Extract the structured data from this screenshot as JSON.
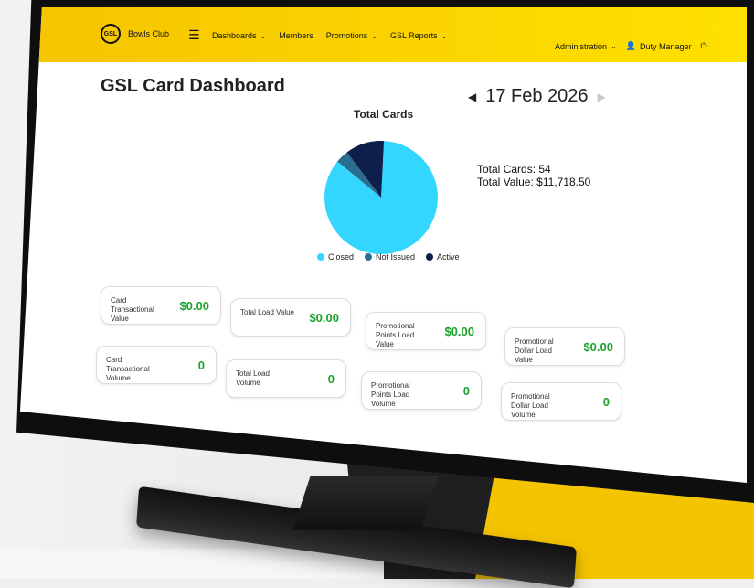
{
  "brand": {
    "name": "Bowls Club",
    "logo_text": "GSL"
  },
  "nav": {
    "items": [
      {
        "label": "Dashboards",
        "dropdown": true
      },
      {
        "label": "Members",
        "dropdown": false
      },
      {
        "label": "Promotions",
        "dropdown": true
      },
      {
        "label": "GSL Reports",
        "dropdown": true
      }
    ],
    "right": {
      "admin": "Administration",
      "user": "Duty Manager"
    }
  },
  "page": {
    "title": "GSL Card Dashboard",
    "date": "17 Feb 2026"
  },
  "chart": {
    "title": "Total Cards",
    "legend": [
      {
        "label": "Closed",
        "color": "#33d6ff"
      },
      {
        "label": "Not Issued",
        "color": "#2a6e8f"
      },
      {
        "label": "Active",
        "color": "#0d1f4a"
      }
    ]
  },
  "totals": {
    "cards": "Total Cards: 54",
    "value": "Total Value: $11,718.50"
  },
  "cards": [
    {
      "label": "Card Transactional Value",
      "value": "$0.00"
    },
    {
      "label": "Total Load Value",
      "value": "$0.00"
    },
    {
      "label": "Promotional Points Load Value",
      "value": "$0.00"
    },
    {
      "label": "Promotional Dollar Load Value",
      "value": "$0.00"
    },
    {
      "label": "Card Transactional Volume",
      "value": "0"
    },
    {
      "label": "Total Load Volume",
      "value": "0"
    },
    {
      "label": "Promotional Points Load Volume",
      "value": "0"
    },
    {
      "label": "Promotional Dollar Load Volume",
      "value": "0"
    }
  ],
  "icons": {
    "hamburger": "menu-icon",
    "chevron": "chevron-down-icon",
    "user": "user-icon",
    "power": "power-icon",
    "prev": "triangle-left-icon",
    "next": "triangle-right-icon"
  },
  "chart_data": {
    "type": "pie",
    "title": "Total Cards",
    "series": [
      {
        "name": "Closed",
        "value": 46
      },
      {
        "name": "Not Issued",
        "value": 2
      },
      {
        "name": "Active",
        "value": 6
      }
    ],
    "legend": "bottom"
  }
}
